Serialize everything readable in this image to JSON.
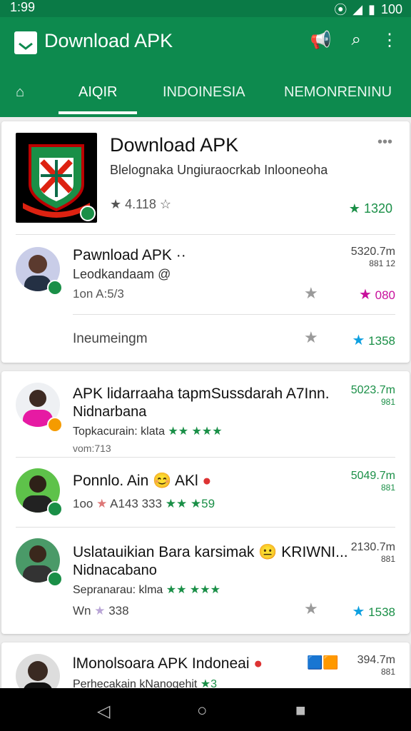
{
  "status": {
    "time": "1:99",
    "battery": "100"
  },
  "appbar": {
    "title": "Download APK"
  },
  "tabs": [
    {
      "label": "AIQIR",
      "active": true
    },
    {
      "label": "INDOINESIA",
      "active": false
    },
    {
      "label": "NEMONRENINU",
      "active": false
    }
  ],
  "hero": {
    "title": "Download APK",
    "subtitle": "Blelognaka Ungiuraocrkab Inlooneoha",
    "rating": "4.118",
    "count": "1320",
    "colors": {
      "accent": "#1a8f47"
    }
  },
  "hero_rows": [
    {
      "title": "Pawnload APK",
      "title_suffix": "··",
      "sub": "Leodkandaam @",
      "meta": "1on A:5/3",
      "size_top": "5320.7m",
      "size_bottom": "881 12",
      "stars": "080",
      "star_color": "#c8109c"
    },
    {
      "title": "",
      "sub": "",
      "meta": "Ineumeingm",
      "size_top": "",
      "size_bottom": "",
      "stars": "1358",
      "star_color": "#0ea0e0"
    }
  ],
  "list1": [
    {
      "title": "APK lidarraaha tapmSussdarah A7Inn.",
      "title2": "Nidnarbana",
      "sub": "Topkacurain: klata",
      "sub_stars": "★★ ★★★",
      "sub2": "vom:713",
      "size_top": "5023.7m",
      "size_bottom": "981",
      "avatar": "pink"
    },
    {
      "title": "Ponnlo. Ain",
      "title_icons": "AKl",
      "meta": "1oo",
      "meta_rating": "A143",
      "meta_extra": "333",
      "meta_stars": "★★ ★59",
      "size_top": "5049.7m",
      "size_bottom": "881",
      "avatar": "green"
    },
    {
      "title": "Uslatauikian Bara karsimak",
      "title_suffix": "KRIWNI...",
      "title2": "Nidnacabano",
      "sub": "Sepranarau: klma",
      "sub_stars": "★★ ★★★",
      "meta": "Wn",
      "meta_rating": "338",
      "size_top": "2130.7m",
      "size_bottom": "881",
      "stars": "1538",
      "avatar": "teal"
    }
  ],
  "list2": [
    {
      "title": "lMonolsoara APK Indoneai",
      "sub": "Perhecakain kNanogehit",
      "sub_stars": "★3",
      "size_top": "394.7m",
      "size_bottom": "881",
      "avatar": "dark"
    }
  ]
}
